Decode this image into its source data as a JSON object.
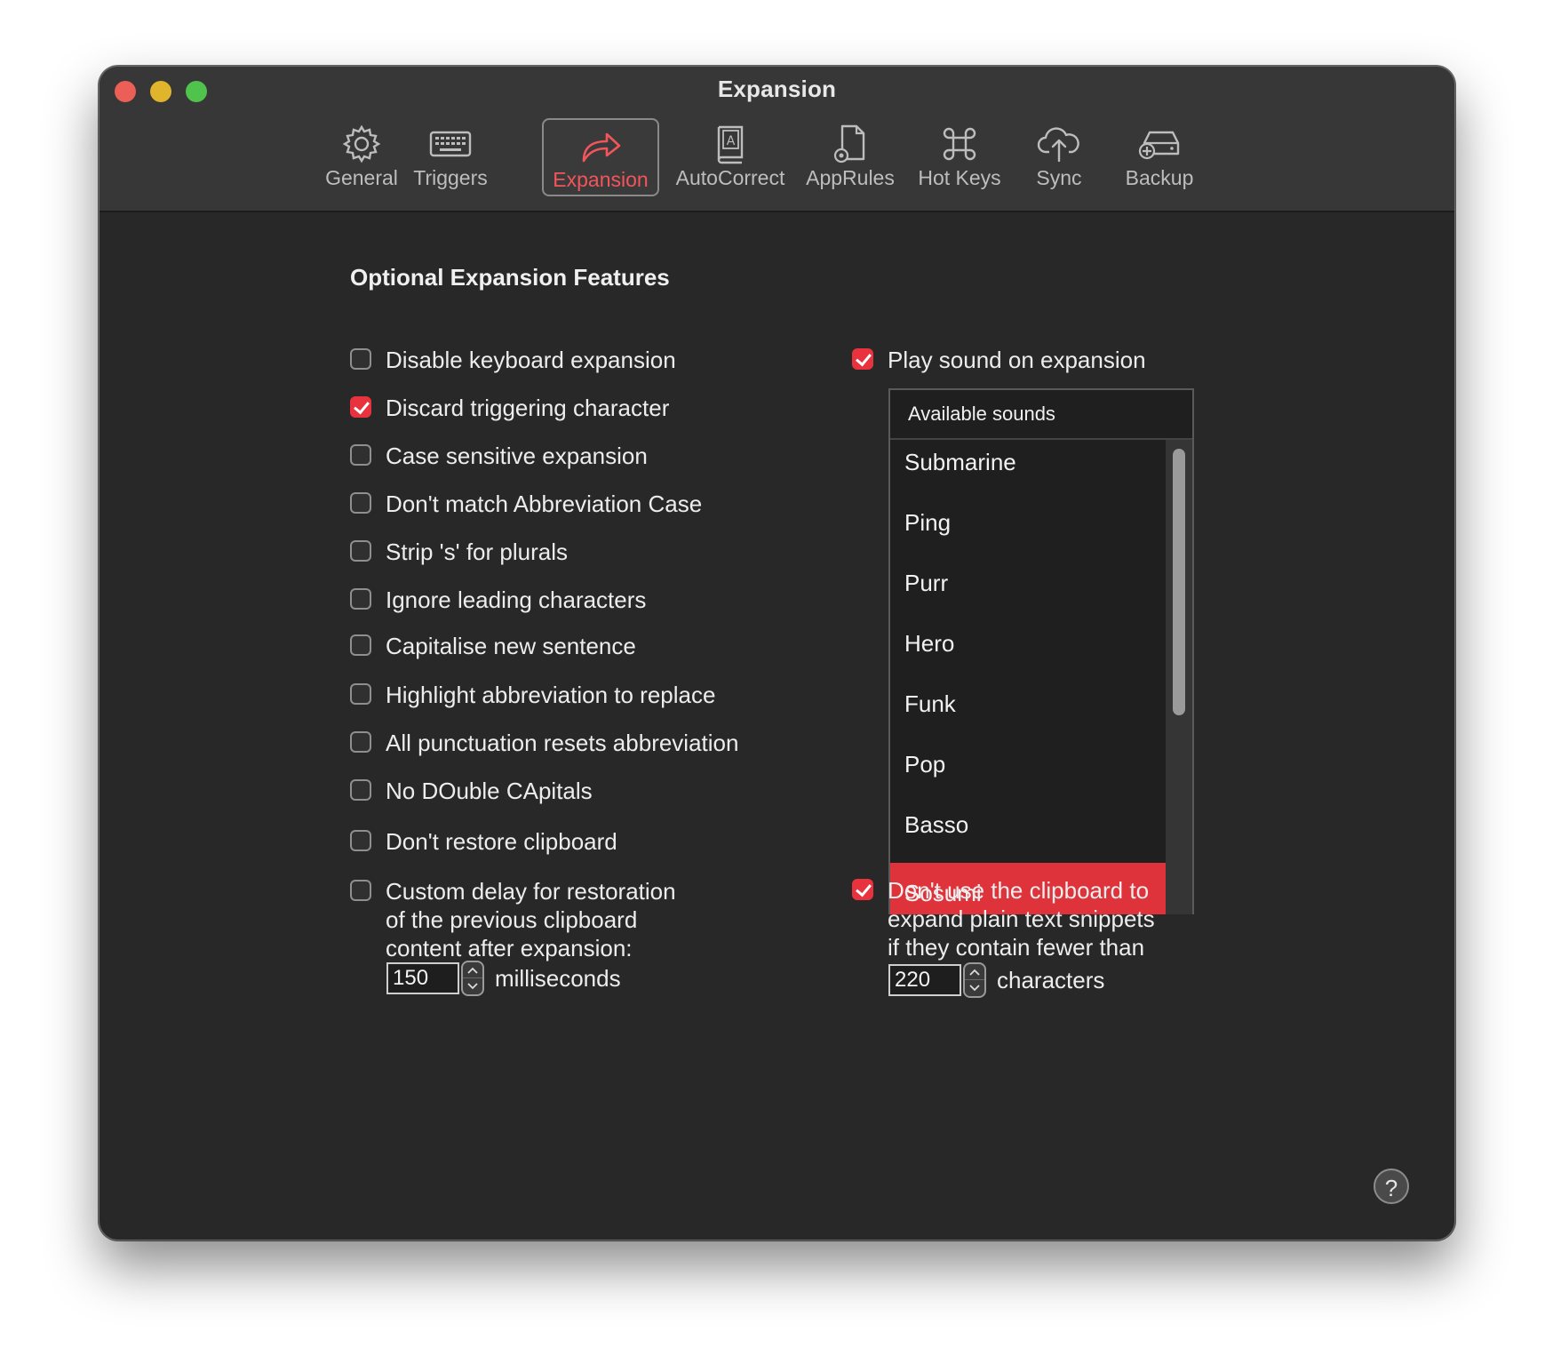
{
  "window": {
    "title": "Expansion"
  },
  "toolbar": {
    "tabs": [
      {
        "label": "General",
        "icon": "gear-icon"
      },
      {
        "label": "Triggers",
        "icon": "keyboard-icon"
      },
      {
        "label": "Expansion",
        "icon": "expand-arrow-icon"
      },
      {
        "label": "AutoCorrect",
        "icon": "dictionary-icon"
      },
      {
        "label": "AppRules",
        "icon": "document-gear-icon"
      },
      {
        "label": "Hot Keys",
        "icon": "command-key-icon"
      },
      {
        "label": "Sync",
        "icon": "cloud-upload-icon"
      },
      {
        "label": "Backup",
        "icon": "drive-add-icon"
      }
    ],
    "active_tab": "Expansion"
  },
  "colors": {
    "accent": "#e8333e",
    "window_bg": "#282828",
    "titlebar_bg": "#373737"
  },
  "content": {
    "section_title": "Optional Expansion Features",
    "left_options": [
      {
        "label": "Disable keyboard expansion",
        "checked": false
      },
      {
        "label": "Discard triggering character",
        "checked": true
      },
      {
        "label": "Case sensitive expansion",
        "checked": false
      },
      {
        "label": "Don't match Abbreviation Case",
        "checked": false
      },
      {
        "label": "Strip 's' for plurals",
        "checked": false
      },
      {
        "label": "Ignore leading characters",
        "checked": false
      },
      {
        "label": "Capitalise new sentence",
        "checked": false
      },
      {
        "label": "Highlight abbreviation to replace",
        "checked": false
      },
      {
        "label": "All punctuation resets abbreviation",
        "checked": false
      },
      {
        "label": "No DOuble CApitals",
        "checked": false
      },
      {
        "label": "Don't restore clipboard",
        "checked": false
      },
      {
        "label": "Custom delay for restoration\nof the previous clipboard\ncontent after expansion:",
        "checked": false
      }
    ],
    "delay": {
      "value": "150",
      "unit": "milliseconds"
    },
    "play_sound": {
      "label": "Play sound on expansion",
      "checked": true
    },
    "sounds": {
      "header": "Available sounds",
      "items": [
        "Submarine",
        "Ping",
        "Purr",
        "Hero",
        "Funk",
        "Pop",
        "Basso",
        "Sosumi"
      ],
      "selected": "Sosumi"
    },
    "clipboard_option": {
      "label": "Don't use the clipboard to\nexpand plain text snippets\nif they contain fewer than",
      "checked": true
    },
    "char_limit": {
      "value": "220",
      "unit": "characters"
    },
    "help_label": "?"
  }
}
